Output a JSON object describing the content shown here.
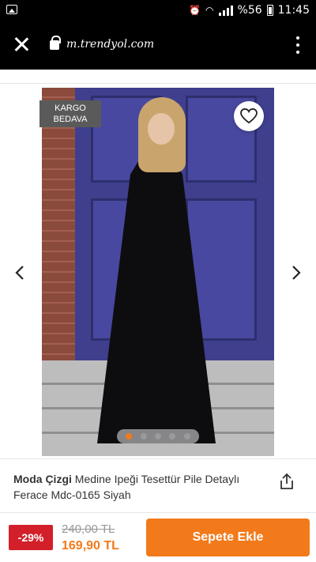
{
  "status_bar": {
    "battery_percent": "%56",
    "time": "11:45"
  },
  "browser": {
    "url": "m.trendyol.com"
  },
  "gallery": {
    "cargo_badge_line1": "KARGO",
    "cargo_badge_line2": "BEDAVA",
    "image_count": 5,
    "active_index": 0
  },
  "product": {
    "brand": "Moda Çizgi",
    "name": "Medine Ipeği Tesettür Pile Detaylı Ferace Mdc-0165 Siyah"
  },
  "pricing": {
    "discount": "-29%",
    "old_price": "240,00 TL",
    "new_price": "169,90 TL"
  },
  "actions": {
    "add_to_cart_label": "Sepete Ekle"
  },
  "colors": {
    "accent": "#f27a1a",
    "discount": "#d21f2a"
  }
}
